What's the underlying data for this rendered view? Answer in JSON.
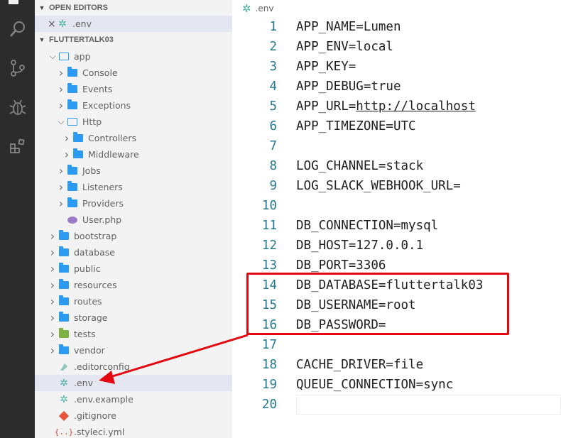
{
  "sidebar": {
    "open_editors": {
      "header": "OPEN EDITORS",
      "items": [
        {
          "close": "×",
          "name": ".env"
        }
      ]
    },
    "project": {
      "header": "FLUTTERTALK03",
      "tree": [
        {
          "label": "app",
          "kind": "folder-open"
        },
        {
          "label": "Console",
          "kind": "folder"
        },
        {
          "label": "Events",
          "kind": "folder"
        },
        {
          "label": "Exceptions",
          "kind": "folder"
        },
        {
          "label": "Http",
          "kind": "folder-open"
        },
        {
          "label": "Controllers",
          "kind": "folder"
        },
        {
          "label": "Middleware",
          "kind": "folder"
        },
        {
          "label": "Jobs",
          "kind": "folder"
        },
        {
          "label": "Listeners",
          "kind": "folder"
        },
        {
          "label": "Providers",
          "kind": "folder"
        },
        {
          "label": "User.php",
          "kind": "php-file"
        },
        {
          "label": "bootstrap",
          "kind": "folder"
        },
        {
          "label": "database",
          "kind": "folder"
        },
        {
          "label": "public",
          "kind": "folder"
        },
        {
          "label": "resources",
          "kind": "folder"
        },
        {
          "label": "routes",
          "kind": "folder"
        },
        {
          "label": "storage",
          "kind": "folder"
        },
        {
          "label": "tests",
          "kind": "folder-tests"
        },
        {
          "label": "vendor",
          "kind": "folder"
        },
        {
          "label": ".editorconfig",
          "kind": "editorconfig-file"
        },
        {
          "label": ".env",
          "kind": "env-file"
        },
        {
          "label": ".env.example",
          "kind": "env-file"
        },
        {
          "label": ".gitignore",
          "kind": "git-file"
        },
        {
          "label": ".styleci.yml",
          "kind": "yaml-file"
        }
      ]
    }
  },
  "editor": {
    "tab": {
      "name": ".env"
    },
    "lines": [
      {
        "n": "1",
        "text": "APP_NAME=Lumen"
      },
      {
        "n": "2",
        "text": "APP_ENV=local"
      },
      {
        "n": "3",
        "text": "APP_KEY="
      },
      {
        "n": "4",
        "text": "APP_DEBUG=true"
      },
      {
        "n": "5",
        "text": "APP_URL=",
        "link": "http://localhost"
      },
      {
        "n": "6",
        "text": "APP_TIMEZONE=UTC"
      },
      {
        "n": "7",
        "text": ""
      },
      {
        "n": "8",
        "text": "LOG_CHANNEL=stack"
      },
      {
        "n": "9",
        "text": "LOG_SLACK_WEBHOOK_URL="
      },
      {
        "n": "10",
        "text": ""
      },
      {
        "n": "11",
        "text": "DB_CONNECTION=mysql"
      },
      {
        "n": "12",
        "text": "DB_HOST=127.0.0.1"
      },
      {
        "n": "13",
        "text": "DB_PORT=3306"
      },
      {
        "n": "14",
        "text": "DB_DATABASE=fluttertalk03"
      },
      {
        "n": "15",
        "text": "DB_USERNAME=root"
      },
      {
        "n": "16",
        "text": "DB_PASSWORD="
      },
      {
        "n": "17",
        "text": ""
      },
      {
        "n": "18",
        "text": "CACHE_DRIVER=file"
      },
      {
        "n": "19",
        "text": "QUEUE_CONNECTION=sync"
      },
      {
        "n": "20",
        "text": ""
      }
    ]
  },
  "colors": {
    "annotation": "#e3070f",
    "folder": "#2b9af3",
    "gear": "#4bb3a5",
    "line_number": "#237893"
  }
}
